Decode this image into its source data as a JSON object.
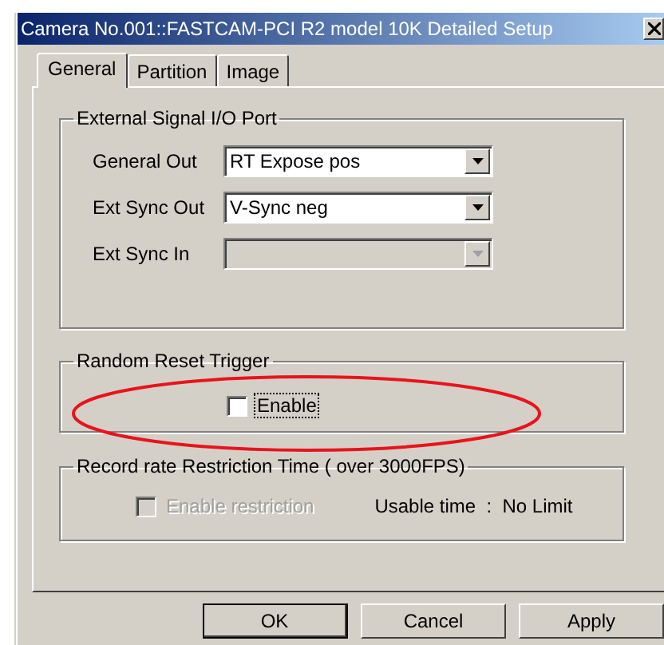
{
  "window": {
    "title": "Camera No.001::FASTCAM-PCI R2 model 10K Detailed Setup"
  },
  "tabs": [
    {
      "label": "General",
      "selected": true
    },
    {
      "label": "Partition",
      "selected": false
    },
    {
      "label": "Image",
      "selected": false
    }
  ],
  "external_signal": {
    "title": "External Signal I/O Port",
    "fields": [
      {
        "label": "General Out",
        "value": "RT Expose pos",
        "disabled": false
      },
      {
        "label": "Ext Sync Out",
        "value": "V-Sync neg",
        "disabled": false
      },
      {
        "label": "Ext Sync In",
        "disabled": true
      }
    ]
  },
  "random_reset": {
    "title": "Random Reset Trigger",
    "checkbox": {
      "label": "Enable",
      "checked": false,
      "focused": true,
      "disabled": false
    }
  },
  "record_rate": {
    "title": "Record rate Restriction Time ( over 3000FPS)",
    "checkbox": {
      "label": "Enable restriction",
      "checked": false,
      "focused": false,
      "disabled": true
    },
    "usable_time": "Usable time  :  No Limit"
  },
  "buttons": [
    {
      "label": "OK",
      "default": true
    },
    {
      "label": "Cancel",
      "default": false
    },
    {
      "label": "Apply",
      "default": false
    }
  ]
}
